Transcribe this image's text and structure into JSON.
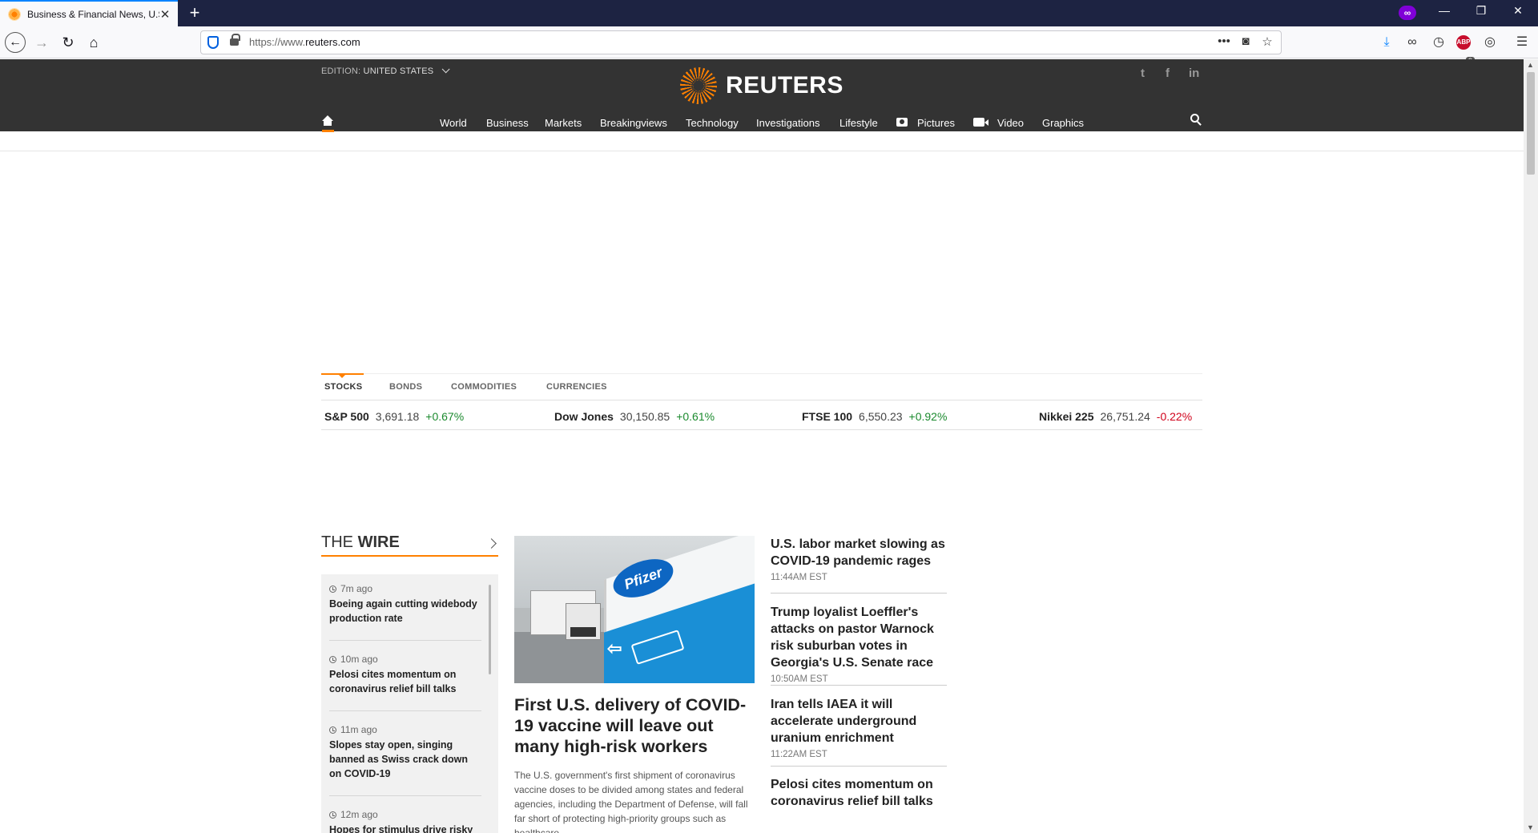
{
  "browser": {
    "tab_title": "Business & Financial News, U.S",
    "new_tab": "+",
    "url_scheme": "https://www.",
    "url_host": "reuters.com",
    "private_badge": "∞",
    "toolbar_badge": "9",
    "abp_label": "ABP"
  },
  "header": {
    "edition_label": "EDITION:",
    "edition_value": "UNITED STATES",
    "logo_text": "REUTERS",
    "social": {
      "twitter": "t",
      "facebook": "f",
      "linkedin": "in"
    },
    "nav": [
      {
        "label": "World"
      },
      {
        "label": "Business"
      },
      {
        "label": "Markets"
      },
      {
        "label": "Breakingviews"
      },
      {
        "label": "Technology"
      },
      {
        "label": "Investigations"
      },
      {
        "label": "Lifestyle"
      },
      {
        "label": "Pictures"
      },
      {
        "label": "Video"
      },
      {
        "label": "Graphics"
      }
    ],
    "accent_color": "#ff8000"
  },
  "market": {
    "tabs": [
      "STOCKS",
      "BONDS",
      "COMMODITIES",
      "CURRENCIES"
    ],
    "active_tab": "STOCKS",
    "quotes": [
      {
        "name": "S&P 500",
        "value": "3,691.18",
        "change": "+0.67%",
        "direction": "up"
      },
      {
        "name": "Dow Jones",
        "value": "30,150.85",
        "change": "+0.61%",
        "direction": "up"
      },
      {
        "name": "FTSE 100",
        "value": "6,550.23",
        "change": "+0.92%",
        "direction": "up"
      },
      {
        "name": "Nikkei 225",
        "value": "26,751.24",
        "change": "-0.22%",
        "direction": "down"
      }
    ]
  },
  "wire": {
    "title_light": "THE ",
    "title_bold": "WIRE",
    "items": [
      {
        "time": "7m ago",
        "headline": "Boeing again cutting widebody production rate"
      },
      {
        "time": "10m ago",
        "headline": "Pelosi cites momentum on coronavirus relief bill talks"
      },
      {
        "time": "11m ago",
        "headline": "Slopes stay open, singing banned as Swiss crack down on COVID-19"
      },
      {
        "time": "12m ago",
        "headline": "Hopes for stimulus drive risky"
      }
    ]
  },
  "lead": {
    "image_sign_text": "Pfizer",
    "title": "First U.S. delivery of COVID-19 vaccine will leave out many high-risk workers",
    "summary": "The U.S. government's first shipment of coronavirus vaccine doses to be divided among states and federal agencies, including the Department of Defense, will fall far short of protecting high-priority groups such as healthcare"
  },
  "stories": [
    {
      "title": "U.S. labor market slowing as COVID-19 pandemic rages",
      "time": "11:44AM EST"
    },
    {
      "title": "Trump loyalist Loeffler's attacks on pastor Warnock risk suburban votes in Georgia's U.S. Senate race",
      "time": "10:50AM EST"
    },
    {
      "title": "Iran tells IAEA it will accelerate underground uranium enrichment",
      "time": "11:22AM EST"
    },
    {
      "title": "Pelosi cites momentum on coronavirus relief bill talks",
      "time": ""
    }
  ]
}
